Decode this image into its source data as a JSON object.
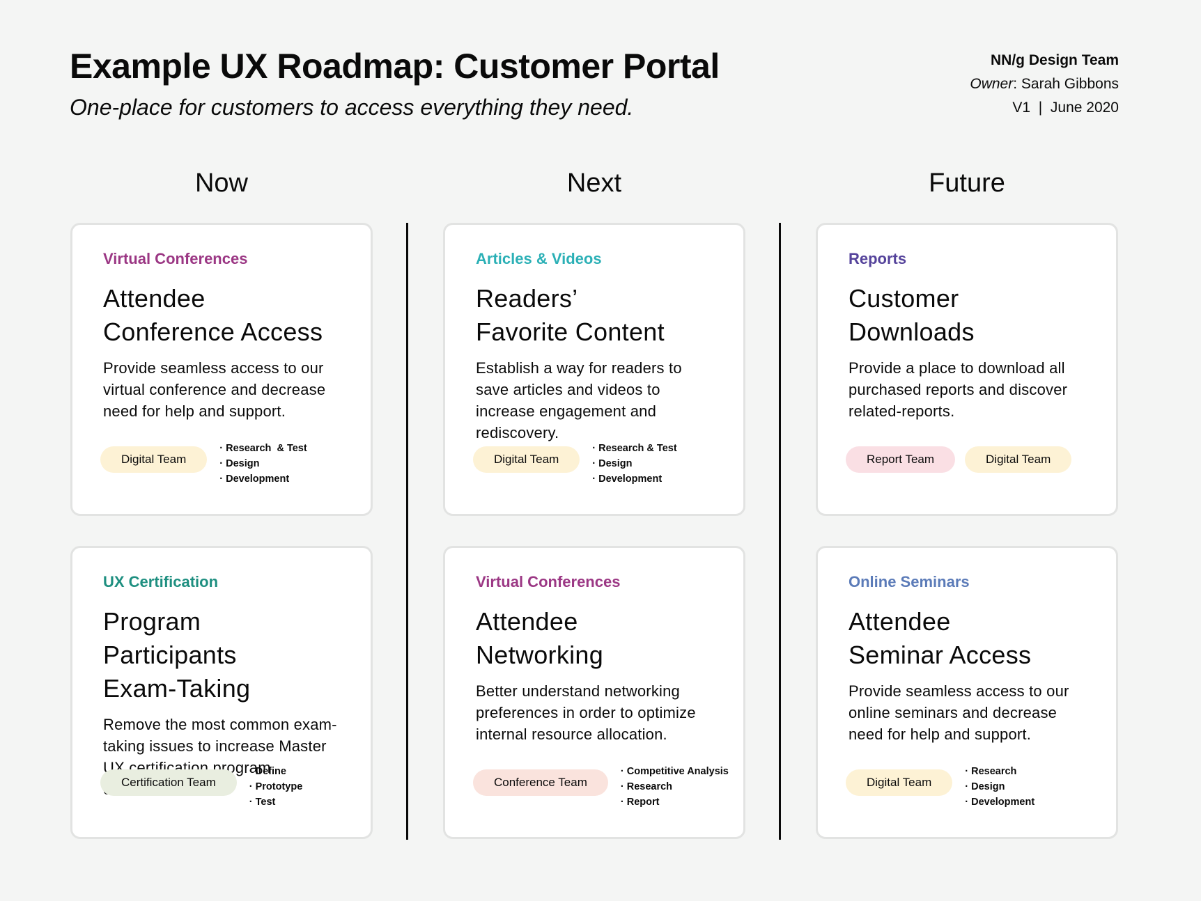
{
  "header": {
    "title": "Example UX Roadmap: Customer Portal",
    "subtitle": "One-place for customers to access everything they need.",
    "team": "NN/g Design Team",
    "owner_label": "Owner",
    "owner_sep": ": ",
    "owner_name": "Sarah Gibbons",
    "version": "V1  |  June 2020"
  },
  "colors": {
    "virtual_conferences": "#9b3784",
    "articles_videos": "#2bb0b6",
    "reports": "#55439b",
    "ux_certification": "#1e8f80",
    "online_seminars": "#5b7bb8",
    "pill_digital": "#fdf2d5",
    "pill_report": "#fadfe4",
    "pill_certification": "#e9eee0",
    "pill_conference": "#fae3dd"
  },
  "columns": [
    {
      "label": "Now",
      "cards": [
        {
          "category": "Virtual Conferences",
          "category_color": "#9b3784",
          "title_lines": [
            "Attendee",
            "Conference Access"
          ],
          "description": "Provide seamless access to our virtual conference and decrease need for help and support.",
          "teams": [
            {
              "label": "Digital Team",
              "color": "#fdf2d5"
            }
          ],
          "tasks": [
            "Research  & Test",
            "Design",
            "Development"
          ]
        },
        {
          "category": "UX Certification",
          "category_color": "#1e8f80",
          "title_lines": [
            "Program Participants",
            "Exam-Taking"
          ],
          "description": "Remove the most common exam-taking issues to increase Master UX certification program enrollment.",
          "teams": [
            {
              "label": "Certification Team",
              "color": "#e9eee0"
            }
          ],
          "tasks": [
            "Define",
            "Prototype",
            "Test"
          ]
        }
      ]
    },
    {
      "label": "Next",
      "cards": [
        {
          "category": "Articles & Videos",
          "category_color": "#2bb0b6",
          "title_lines": [
            "Readers’",
            "Favorite Content"
          ],
          "description": "Establish a way for readers to save articles and videos to increase engagement and rediscovery.",
          "teams": [
            {
              "label": "Digital Team",
              "color": "#fdf2d5"
            }
          ],
          "tasks": [
            "Research & Test",
            "Design",
            "Development"
          ]
        },
        {
          "category": "Virtual Conferences",
          "category_color": "#9b3784",
          "title_lines": [
            "Attendee",
            "Networking"
          ],
          "description": "Better understand networking preferences in order to optimize internal resource allocation.",
          "teams": [
            {
              "label": "Conference Team",
              "color": "#fae3dd"
            }
          ],
          "tasks": [
            "Competitive Analysis",
            "Research",
            "Report"
          ]
        }
      ]
    },
    {
      "label": "Future",
      "cards": [
        {
          "category": "Reports",
          "category_color": "#55439b",
          "title_lines": [
            "Customer",
            "Downloads"
          ],
          "description": "Provide a place to download all purchased reports and discover related-reports.",
          "teams": [
            {
              "label": "Report Team",
              "color": "#fadfe4"
            },
            {
              "label": "Digital Team",
              "color": "#fdf2d5"
            }
          ],
          "tasks": []
        },
        {
          "category": "Online Seminars",
          "category_color": "#5b7bb8",
          "title_lines": [
            "Attendee",
            "Seminar Access"
          ],
          "description": "Provide seamless access to our online seminars and decrease need for help and support.",
          "teams": [
            {
              "label": "Digital Team",
              "color": "#fdf2d5"
            }
          ],
          "tasks": [
            "Research",
            "Design",
            "Development"
          ]
        }
      ]
    }
  ]
}
